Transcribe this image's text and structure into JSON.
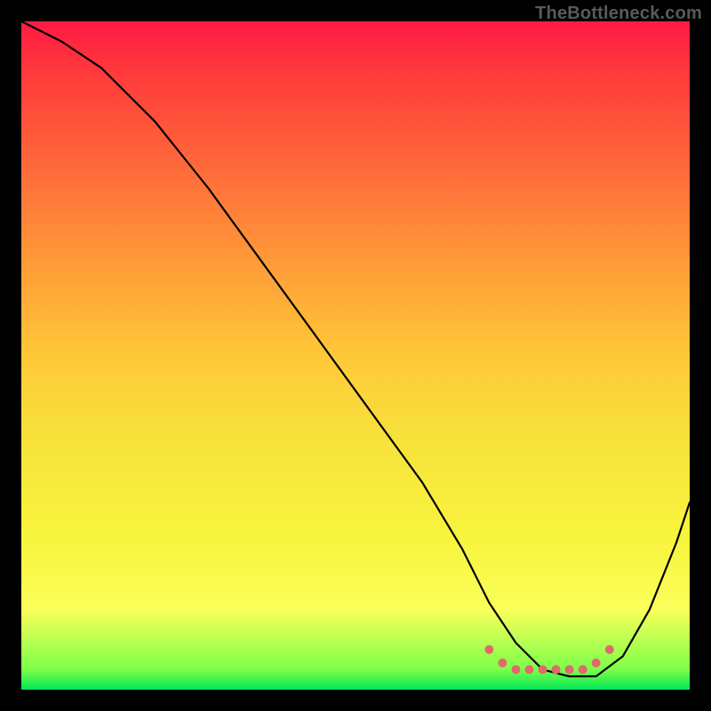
{
  "watermark": "TheBottleneck.com",
  "chart_data": {
    "type": "line",
    "title": "",
    "xlabel": "",
    "ylabel": "",
    "xlim": [
      0,
      100
    ],
    "ylim": [
      0,
      100
    ],
    "grid": false,
    "series": [
      {
        "name": "curve",
        "color": "#000000",
        "x": [
          0,
          6,
          12,
          20,
          28,
          36,
          44,
          52,
          60,
          66,
          70,
          74,
          78,
          82,
          86,
          90,
          94,
          98,
          100
        ],
        "y": [
          100,
          97,
          93,
          85,
          75,
          64,
          53,
          42,
          31,
          21,
          13,
          7,
          3,
          2,
          2,
          5,
          12,
          22,
          28
        ]
      }
    ],
    "markers": {
      "name": "bottom-cluster",
      "color": "#e06a6a",
      "radius": 5,
      "points": [
        {
          "x": 70,
          "y": 6
        },
        {
          "x": 72,
          "y": 4
        },
        {
          "x": 74,
          "y": 3
        },
        {
          "x": 76,
          "y": 3
        },
        {
          "x": 78,
          "y": 3
        },
        {
          "x": 80,
          "y": 3
        },
        {
          "x": 82,
          "y": 3
        },
        {
          "x": 84,
          "y": 3
        },
        {
          "x": 86,
          "y": 4
        },
        {
          "x": 88,
          "y": 6
        }
      ]
    }
  }
}
